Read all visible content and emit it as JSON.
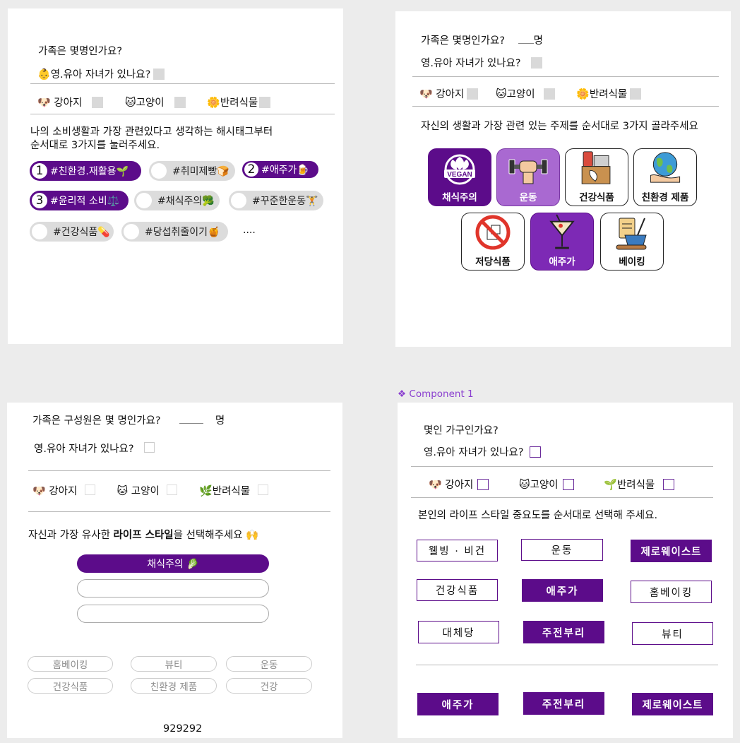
{
  "panel1": {
    "q_family": "가족은 몇명인가요?",
    "q_kids": "영.유아 자녀가 있나요?",
    "pets": [
      {
        "emoji": "🐶",
        "label": "강아지"
      },
      {
        "emoji": "🐱",
        "label": "고양이"
      },
      {
        "emoji": "🌼",
        "label": "반려식물"
      }
    ],
    "instruction_line1": "나의 소비생활과 가장 관련있다고 생각하는 해시태그부터",
    "instruction_line2": "순서대로 3가지를 눌러주세요.",
    "tags": [
      {
        "num": "1",
        "label": "#친환경.재활용🌱",
        "selected": true
      },
      {
        "num": "",
        "label": "#취미제빵🍞",
        "selected": false
      },
      {
        "num": "2",
        "label": "#애주가🍺",
        "selected": true
      },
      {
        "num": "3",
        "label": "#윤리적 소비⚖️",
        "selected": true
      },
      {
        "num": "",
        "label": "#채식주의🥦",
        "selected": false
      },
      {
        "num": "",
        "label": "#꾸준한운동🏋",
        "selected": false
      },
      {
        "num": "",
        "label": "#건강식품💊",
        "selected": false
      },
      {
        "num": "",
        "label": "#당섭취줄이기🍯",
        "selected": false
      }
    ],
    "more": "...."
  },
  "panel2": {
    "q_family": "가족은 몇명인가요?",
    "q_family_unit": "명",
    "q_kids": "영.유아 자녀가 있나요?",
    "pets": [
      {
        "emoji": "🐶",
        "label": "강아지"
      },
      {
        "emoji": "🐱",
        "label": "고양이"
      },
      {
        "emoji": "🌼",
        "label": "반려식물"
      }
    ],
    "instruction": "자신의 생활과 가장 관련 있는 주제를 순서대로 3가지 골라주세요",
    "cards": [
      {
        "label": "채식주의",
        "icon": "vegan-icon",
        "state": "dark"
      },
      {
        "label": "운동",
        "icon": "fitness-icon",
        "state": "mid"
      },
      {
        "label": "건강식품",
        "icon": "health-food-icon",
        "state": "white"
      },
      {
        "label": "친환경 제품",
        "icon": "eco-earth-icon",
        "state": "white"
      },
      {
        "label": "저당식품",
        "icon": "no-sugar-icon",
        "state": "white"
      },
      {
        "label": "애주가",
        "icon": "cocktail-icon",
        "state": "selp"
      },
      {
        "label": "베이킹",
        "icon": "baking-icon",
        "state": "white"
      }
    ],
    "vegan_text": "VEGAN"
  },
  "panel3": {
    "q_family": "가족은 구성원은 몇 명인가요?",
    "q_family_unit": "명",
    "q_kids": "영.유아 자녀가 있나요?",
    "pets": [
      {
        "emoji": "🐶",
        "label": "강아지"
      },
      {
        "emoji": "🐱",
        "label": "고양이"
      },
      {
        "emoji": "🌿",
        "label": "반려식물"
      }
    ],
    "instruction_pre": "자신과 가장 유사한 ",
    "instruction_bold": "라이프 스타일",
    "instruction_post": "을 선택해주세요 🙌",
    "ranked": [
      "채식주의 🥬",
      "",
      ""
    ],
    "options": [
      "홈베이킹",
      "뷰티",
      "운동",
      "건강식품",
      "친환경 제품",
      "건강"
    ],
    "footer_number": "929292"
  },
  "panel4": {
    "component_label": "❖ Component 1",
    "q_family": "몇인 가구인가요?",
    "q_kids": "영.유아 자녀가 있나요?",
    "pets": [
      {
        "emoji": "🐶",
        "label": "강아지"
      },
      {
        "emoji": "🐱",
        "label": "고양이"
      },
      {
        "emoji": "🌱",
        "label": "반려식물"
      }
    ],
    "instruction": "본인의 라이프 스타일 중요도를 순서대로 선택해 주세요.",
    "grid": [
      {
        "label": "웰빙 · 비건",
        "filled": false
      },
      {
        "label": "운동",
        "filled": false
      },
      {
        "label": "제로웨이스트",
        "filled": true
      },
      {
        "label": "건강식품",
        "filled": false
      },
      {
        "label": "애주가",
        "filled": true
      },
      {
        "label": "홈베이킹",
        "filled": false
      },
      {
        "label": "대체당",
        "filled": false
      },
      {
        "label": "주전부리",
        "filled": true
      },
      {
        "label": "뷰티",
        "filled": false
      }
    ],
    "selected": [
      "애주가",
      "주전부리",
      "제로웨이스트"
    ]
  },
  "colors": {
    "accent": "#5c0c8a",
    "accent_light": "#a969d1",
    "chip_gray": "#dcdcdc",
    "checkbox_gray": "#d9d9d9"
  }
}
